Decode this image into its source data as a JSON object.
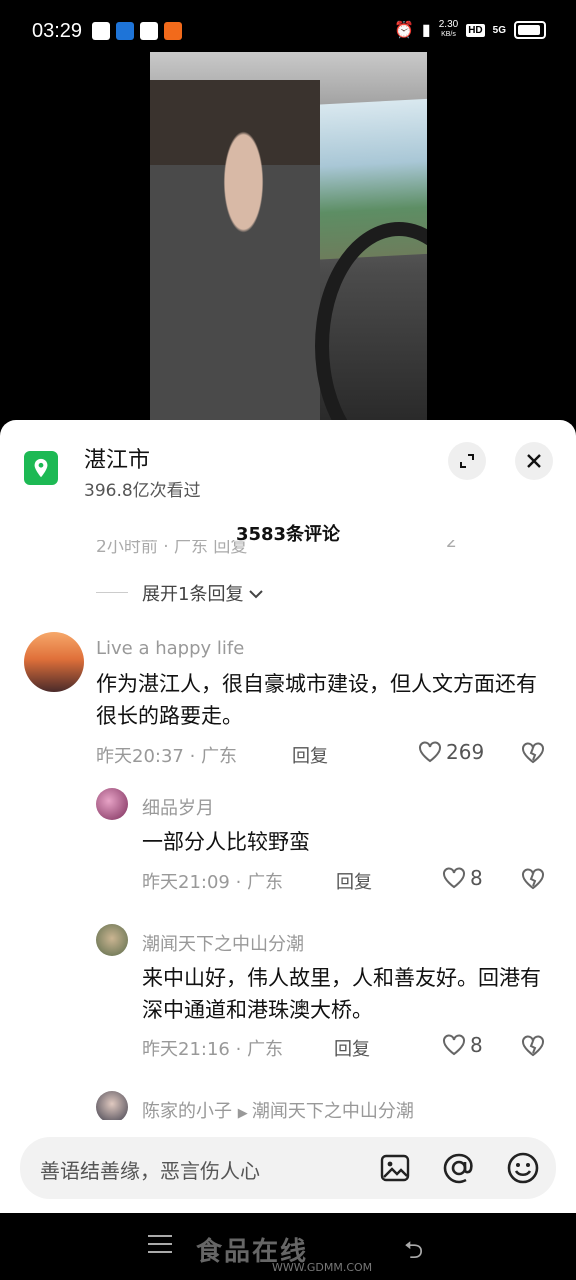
{
  "status_bar": {
    "time": "03:29",
    "net_speed": "2.30",
    "net_unit": "KB/s",
    "hd": "HD",
    "signal": "5G"
  },
  "location": {
    "title": "湛江市",
    "views": "396.8亿次看过"
  },
  "comments_header": {
    "count": "3583条评论"
  },
  "cut_row": {
    "text": "2小时前 · 广东  回复",
    "likes": "2"
  },
  "expand_replies": "展开1条回复",
  "comments": [
    {
      "name": "Live a happy life",
      "text": "作为湛江人，很自豪城市建设，但人文方面还有很长的路要走。",
      "time": "昨天20:37",
      "region": "广东",
      "reply": "回复",
      "likes": "269"
    },
    {
      "name": "细品岁月",
      "text": "一部分人比较野蛮",
      "time": "昨天21:09",
      "region": "广东",
      "reply": "回复",
      "likes": "8"
    },
    {
      "name": "潮闻天下之中山分潮",
      "text": "来中山好，伟人故里，人和善友好。回港有深中通道和港珠澳大桥。",
      "time": "昨天21:16",
      "region": "广东",
      "reply": "回复",
      "likes": "8"
    },
    {
      "name": "陈家的小子",
      "reply_to": "潮闻天下之中山分潮"
    }
  ],
  "input": {
    "placeholder": "善语结善缘，恶言伤人心"
  },
  "watermark": {
    "brand": "食品在线",
    "url": "WWW.GDMM.COM"
  },
  "colors": {
    "accent_green": "#1db954"
  },
  "icons": [
    "location-pin-icon",
    "expand-icon",
    "close-icon",
    "chevron-down-icon",
    "heart-icon",
    "broken-heart-icon",
    "image-icon",
    "at-icon",
    "emoji-icon",
    "menu-icon",
    "back-icon"
  ]
}
